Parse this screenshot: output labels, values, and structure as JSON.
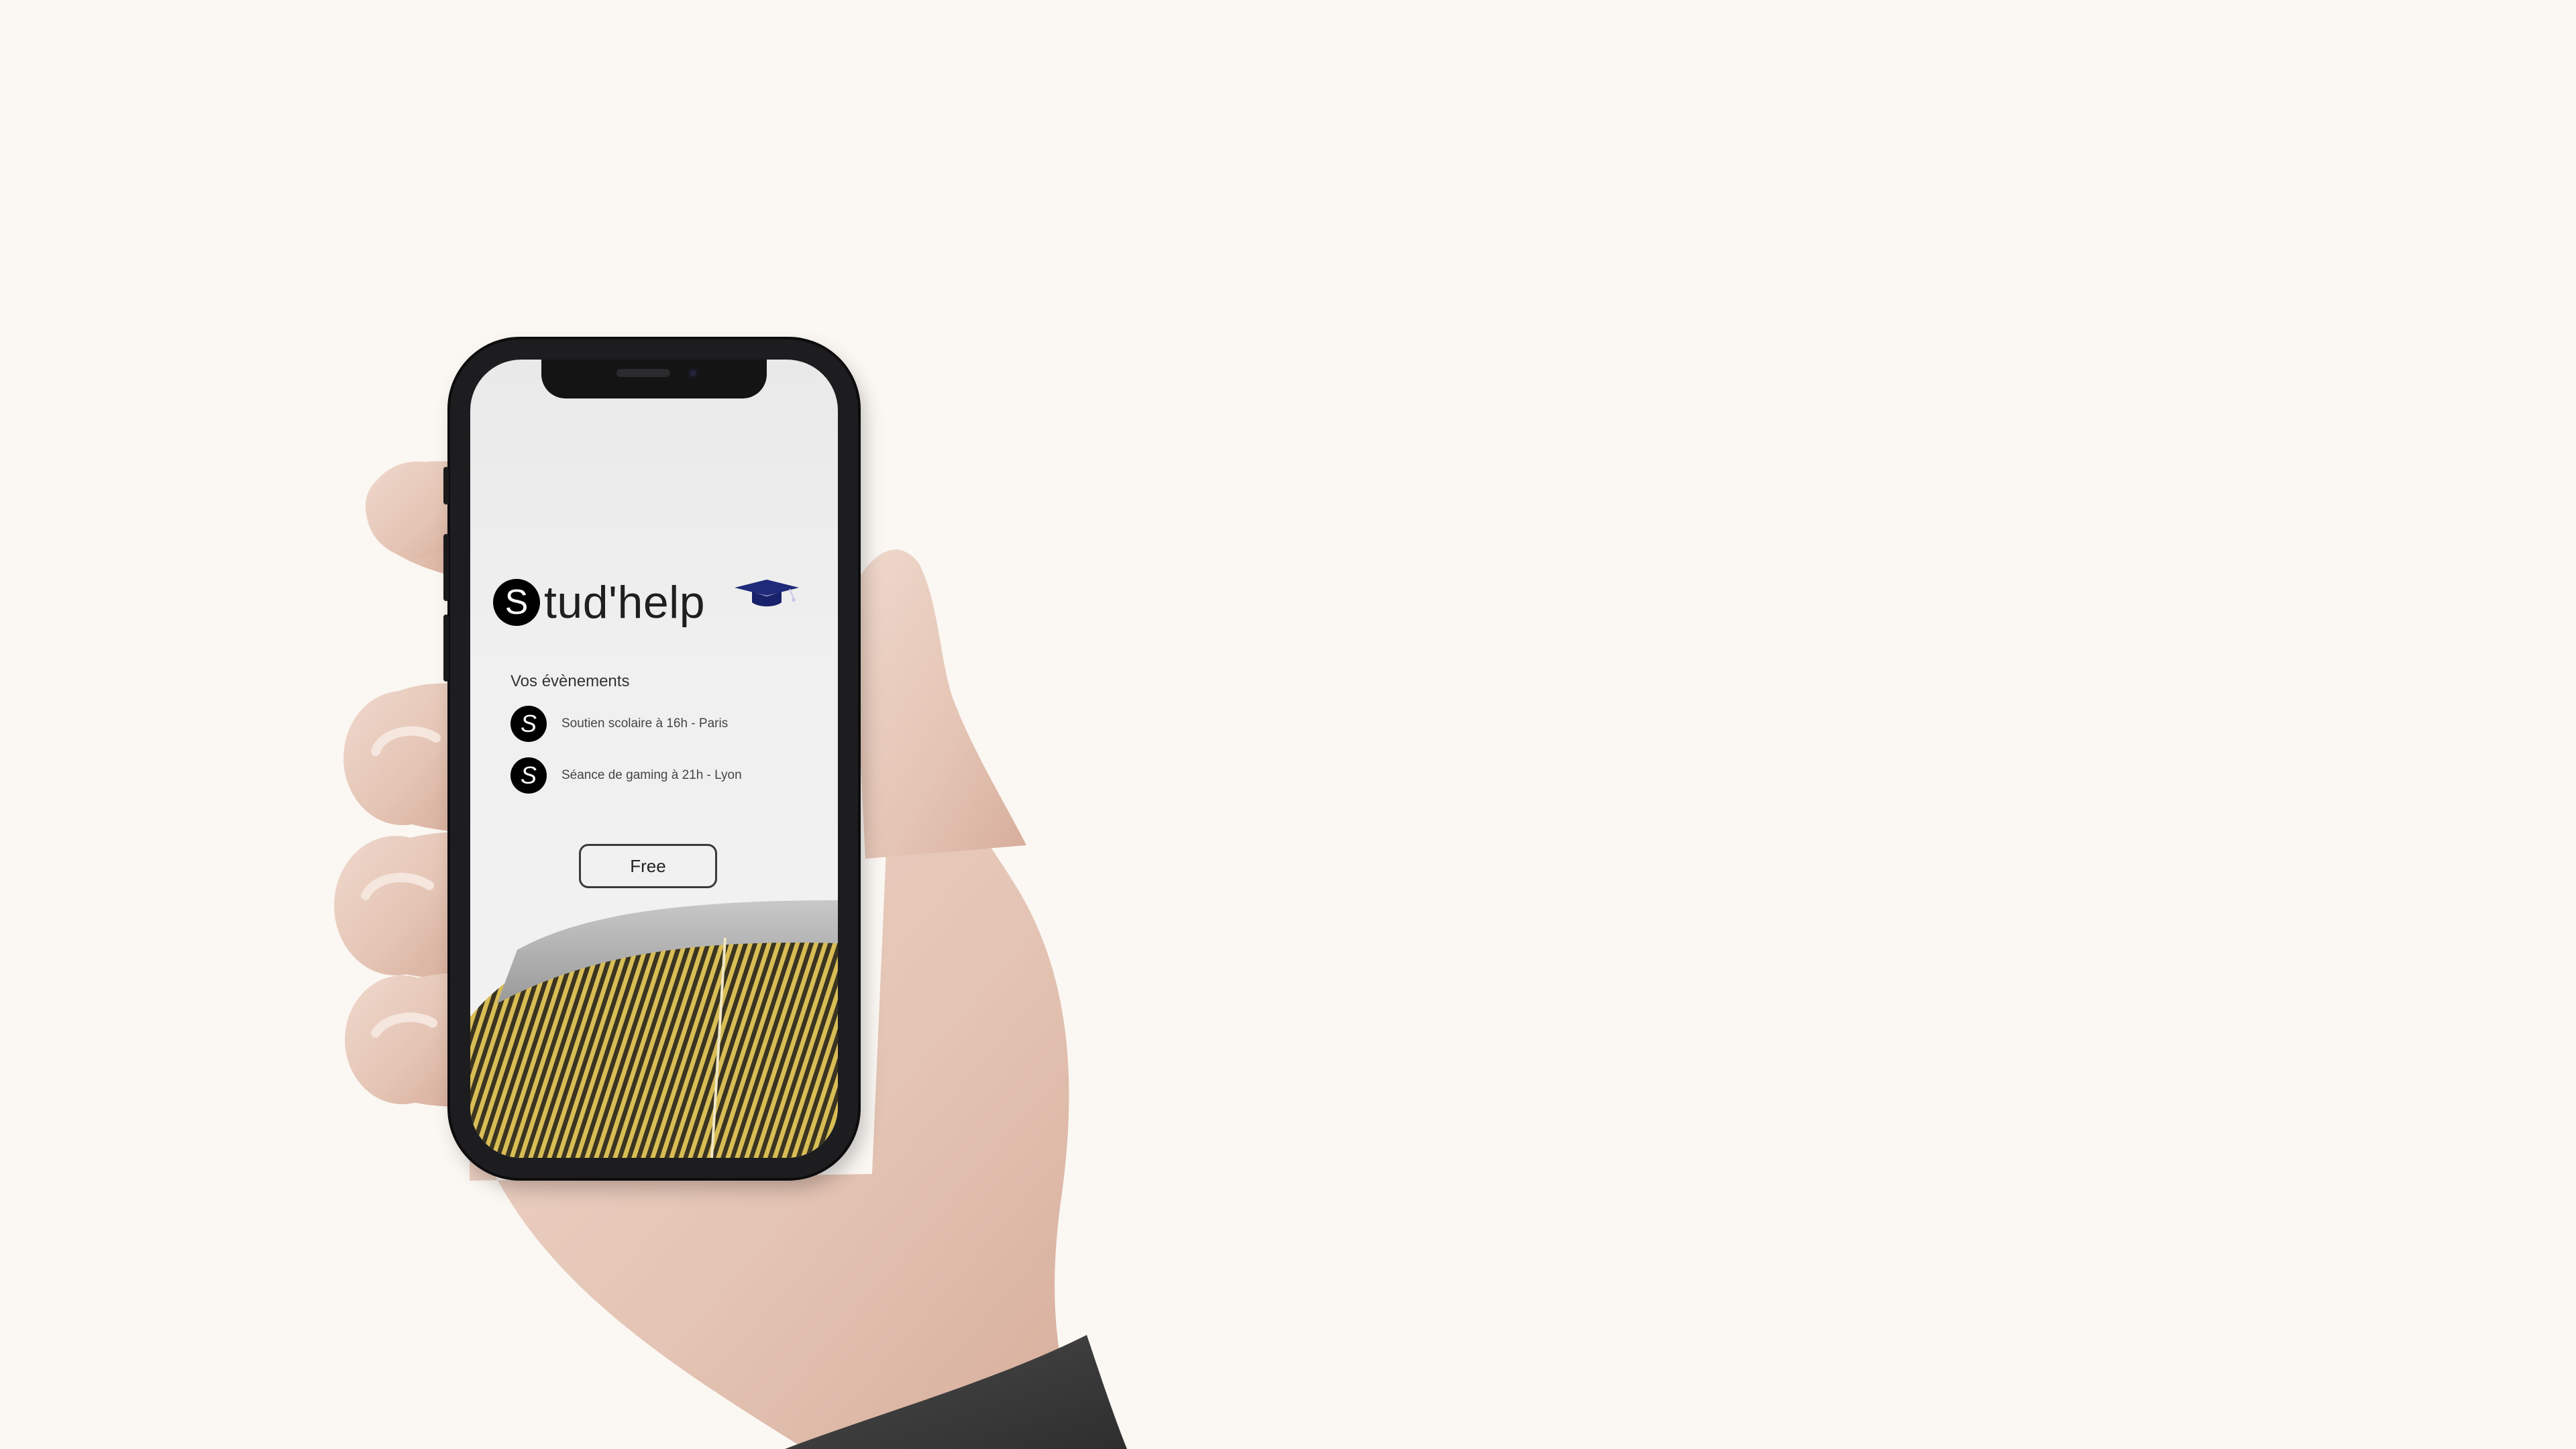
{
  "app": {
    "logo_letter": "S",
    "name_rest": "tud'help"
  },
  "events": {
    "title": "Vos évènements",
    "items": [
      {
        "icon_letter": "S",
        "label": "Soutien scolaire à 16h - Paris"
      },
      {
        "icon_letter": "S",
        "label": "Séance de gaming à 21h - Lyon"
      }
    ]
  },
  "actions": {
    "free_label": "Free"
  },
  "colors": {
    "background": "#fbf7f3",
    "cap": "#1f2a7a",
    "building_gold": "#c9a93a"
  }
}
